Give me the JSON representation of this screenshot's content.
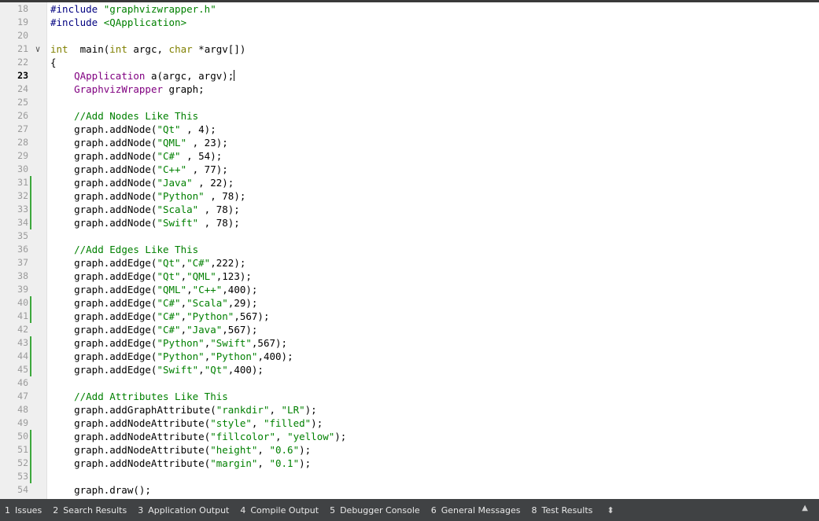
{
  "editor": {
    "current_line": 23,
    "lines": [
      {
        "n": 18,
        "t": [
          [
            "pp",
            "#include "
          ],
          [
            "str",
            "\"graphvizwrapper.h\""
          ]
        ]
      },
      {
        "n": 19,
        "t": [
          [
            "pp",
            "#include "
          ],
          [
            "str",
            "<QApplication>"
          ]
        ]
      },
      {
        "n": 20,
        "t": []
      },
      {
        "n": 21,
        "fold": true,
        "t": [
          [
            "kw",
            "int"
          ],
          [
            "",
            "  "
          ],
          [
            "",
            "main("
          ],
          [
            "kw",
            "int"
          ],
          [
            "",
            " argc, "
          ],
          [
            "kw",
            "char"
          ],
          [
            "",
            " *argv[])"
          ]
        ]
      },
      {
        "n": 22,
        "t": [
          [
            "",
            "{"
          ]
        ]
      },
      {
        "n": 23,
        "cursor": true,
        "t": [
          [
            "",
            "    "
          ],
          [
            "ty",
            "QApplication"
          ],
          [
            "",
            " a(argc, argv);"
          ]
        ]
      },
      {
        "n": 24,
        "t": [
          [
            "",
            "    "
          ],
          [
            "ty",
            "GraphvizWrapper"
          ],
          [
            "",
            " graph;"
          ]
        ]
      },
      {
        "n": 25,
        "t": []
      },
      {
        "n": 26,
        "t": [
          [
            "",
            "    "
          ],
          [
            "cm",
            "//Add Nodes Like This"
          ]
        ]
      },
      {
        "n": 27,
        "t": [
          [
            "",
            "    graph.addNode("
          ],
          [
            "str",
            "\"Qt\""
          ],
          [
            "",
            " , 4);"
          ]
        ]
      },
      {
        "n": 28,
        "t": [
          [
            "",
            "    graph.addNode("
          ],
          [
            "str",
            "\"QML\""
          ],
          [
            "",
            " , 23);"
          ]
        ]
      },
      {
        "n": 29,
        "t": [
          [
            "",
            "    graph.addNode("
          ],
          [
            "str",
            "\"C#\""
          ],
          [
            "",
            " , 54);"
          ]
        ]
      },
      {
        "n": 30,
        "t": [
          [
            "",
            "    graph.addNode("
          ],
          [
            "str",
            "\"C++\""
          ],
          [
            "",
            " , 77);"
          ]
        ]
      },
      {
        "n": 31,
        "mark": true,
        "t": [
          [
            "",
            "    graph.addNode("
          ],
          [
            "str",
            "\"Java\""
          ],
          [
            "",
            " , 22);"
          ]
        ]
      },
      {
        "n": 32,
        "mark": true,
        "t": [
          [
            "",
            "    graph.addNode("
          ],
          [
            "str",
            "\"Python\""
          ],
          [
            "",
            " , 78);"
          ]
        ]
      },
      {
        "n": 33,
        "mark": true,
        "t": [
          [
            "",
            "    graph.addNode("
          ],
          [
            "str",
            "\"Scala\""
          ],
          [
            "",
            " , 78);"
          ]
        ]
      },
      {
        "n": 34,
        "mark": true,
        "t": [
          [
            "",
            "    graph.addNode("
          ],
          [
            "str",
            "\"Swift\""
          ],
          [
            "",
            " , 78);"
          ]
        ]
      },
      {
        "n": 35,
        "t": []
      },
      {
        "n": 36,
        "t": [
          [
            "",
            "    "
          ],
          [
            "cm",
            "//Add Edges Like This"
          ]
        ]
      },
      {
        "n": 37,
        "t": [
          [
            "",
            "    graph.addEdge("
          ],
          [
            "str",
            "\"Qt\""
          ],
          [
            "",
            ","
          ],
          [
            "str",
            "\"C#\""
          ],
          [
            "",
            ",222);"
          ]
        ]
      },
      {
        "n": 38,
        "t": [
          [
            "",
            "    graph.addEdge("
          ],
          [
            "str",
            "\"Qt\""
          ],
          [
            "",
            ","
          ],
          [
            "str",
            "\"QML\""
          ],
          [
            "",
            ",123);"
          ]
        ]
      },
      {
        "n": 39,
        "t": [
          [
            "",
            "    graph.addEdge("
          ],
          [
            "str",
            "\"QML\""
          ],
          [
            "",
            ","
          ],
          [
            "str",
            "\"C++\""
          ],
          [
            "",
            ",400);"
          ]
        ]
      },
      {
        "n": 40,
        "mark": true,
        "t": [
          [
            "",
            "    graph.addEdge("
          ],
          [
            "str",
            "\"C#\""
          ],
          [
            "",
            ","
          ],
          [
            "str",
            "\"Scala\""
          ],
          [
            "",
            ",29);"
          ]
        ]
      },
      {
        "n": 41,
        "mark": true,
        "t": [
          [
            "",
            "    graph.addEdge("
          ],
          [
            "str",
            "\"C#\""
          ],
          [
            "",
            ","
          ],
          [
            "str",
            "\"Python\""
          ],
          [
            "",
            ",567);"
          ]
        ]
      },
      {
        "n": 42,
        "t": [
          [
            "",
            "    graph.addEdge("
          ],
          [
            "str",
            "\"C#\""
          ],
          [
            "",
            ","
          ],
          [
            "str",
            "\"Java\""
          ],
          [
            "",
            ",567);"
          ]
        ]
      },
      {
        "n": 43,
        "mark": true,
        "t": [
          [
            "",
            "    graph.addEdge("
          ],
          [
            "str",
            "\"Python\""
          ],
          [
            "",
            ","
          ],
          [
            "str",
            "\"Swift\""
          ],
          [
            "",
            ",567);"
          ]
        ]
      },
      {
        "n": 44,
        "mark": true,
        "t": [
          [
            "",
            "    graph.addEdge("
          ],
          [
            "str",
            "\"Python\""
          ],
          [
            "",
            ","
          ],
          [
            "str",
            "\"Python\""
          ],
          [
            "",
            ",400);"
          ]
        ]
      },
      {
        "n": 45,
        "mark": true,
        "t": [
          [
            "",
            "    graph.addEdge("
          ],
          [
            "str",
            "\"Swift\""
          ],
          [
            "",
            ","
          ],
          [
            "str",
            "\"Qt\""
          ],
          [
            "",
            ",400);"
          ]
        ]
      },
      {
        "n": 46,
        "t": []
      },
      {
        "n": 47,
        "t": [
          [
            "",
            "    "
          ],
          [
            "cm",
            "//Add Attributes Like This"
          ]
        ]
      },
      {
        "n": 48,
        "t": [
          [
            "",
            "    graph.addGraphAttribute("
          ],
          [
            "str",
            "\"rankdir\""
          ],
          [
            "",
            ", "
          ],
          [
            "str",
            "\"LR\""
          ],
          [
            "",
            ");"
          ]
        ]
      },
      {
        "n": 49,
        "t": [
          [
            "",
            "    graph.addNodeAttribute("
          ],
          [
            "str",
            "\"style\""
          ],
          [
            "",
            ", "
          ],
          [
            "str",
            "\"filled\""
          ],
          [
            "",
            ");"
          ]
        ]
      },
      {
        "n": 50,
        "mark": true,
        "t": [
          [
            "",
            "    graph.addNodeAttribute("
          ],
          [
            "str",
            "\"fillcolor\""
          ],
          [
            "",
            ", "
          ],
          [
            "str",
            "\"yellow\""
          ],
          [
            "",
            ");"
          ]
        ]
      },
      {
        "n": 51,
        "mark": true,
        "t": [
          [
            "",
            "    graph.addNodeAttribute("
          ],
          [
            "str",
            "\"height\""
          ],
          [
            "",
            ", "
          ],
          [
            "str",
            "\"0.6\""
          ],
          [
            "",
            ");"
          ]
        ]
      },
      {
        "n": 52,
        "mark": true,
        "t": [
          [
            "",
            "    graph.addNodeAttribute("
          ],
          [
            "str",
            "\"margin\""
          ],
          [
            "",
            ", "
          ],
          [
            "str",
            "\"0.1\""
          ],
          [
            "",
            ");"
          ]
        ]
      },
      {
        "n": 53,
        "mark": true,
        "t": []
      },
      {
        "n": 54,
        "t": [
          [
            "",
            "    graph.draw();"
          ]
        ]
      }
    ]
  },
  "output_panes": {
    "tabs": [
      {
        "num": "1",
        "label": "Issues"
      },
      {
        "num": "2",
        "label": "Search Results"
      },
      {
        "num": "3",
        "label": "Application Output"
      },
      {
        "num": "4",
        "label": "Compile Output"
      },
      {
        "num": "5",
        "label": "Debugger Console"
      },
      {
        "num": "6",
        "label": "General Messages"
      },
      {
        "num": "8",
        "label": "Test Results"
      }
    ],
    "more_icon": "up-down-chevron-icon",
    "maximize_icon": "up-arrow-icon"
  },
  "colors": {
    "preprocessor": "#000080",
    "string": "#008000",
    "keyword": "#808000",
    "type": "#800080",
    "comment": "#008000",
    "change_marker": "#3da83d",
    "output_bar": "#404244"
  }
}
